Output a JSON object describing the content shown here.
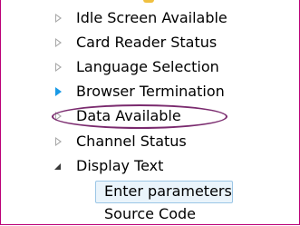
{
  "tree": {
    "items": [
      {
        "label": "Idle Screen Available",
        "state": "collapsed"
      },
      {
        "label": "Card Reader Status",
        "state": "collapsed"
      },
      {
        "label": "Language Selection",
        "state": "collapsed"
      },
      {
        "label": "Browser Termination",
        "state": "collapsed-highlighted"
      },
      {
        "label": "Data Available",
        "state": "collapsed"
      },
      {
        "label": "Channel Status",
        "state": "collapsed"
      },
      {
        "label": "Display Text",
        "state": "expanded",
        "children": [
          {
            "label": "Enter parameters",
            "selected": true
          },
          {
            "label": "Source Code",
            "selected": false
          }
        ]
      }
    ]
  },
  "colors": {
    "frame_border": "#bb0077",
    "annotation_ellipse": "#7a2a6e",
    "selection_bg": "#eaf4fb",
    "selection_border": "#9cc6e6",
    "twisty_highlight": "#1a9ae6"
  },
  "icons": [
    "twisty-collapsed-icon",
    "twisty-expanded-icon"
  ]
}
